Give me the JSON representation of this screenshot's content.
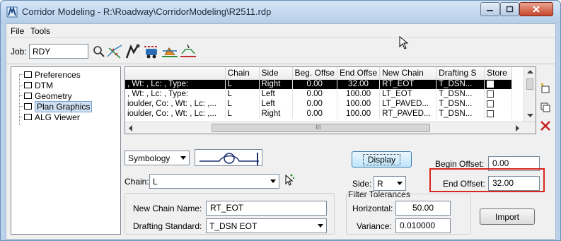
{
  "window": {
    "title": "Corridor Modeling - R:\\Roadway\\CorridorModeling\\R2511.rdp"
  },
  "menu": {
    "file": "File",
    "tools": "Tools"
  },
  "toolbar": {
    "job_label": "Job:",
    "job_value": "RDY"
  },
  "tree": {
    "items": [
      "Preferences",
      "DTM",
      "Geometry",
      "Plan Graphics",
      "ALG Viewer"
    ]
  },
  "grid": {
    "columns": [
      "",
      "Chain",
      "Side",
      "Beg. Offse",
      "End Offse",
      "New Chain",
      "Drafting S",
      "Store"
    ],
    "rows": [
      [
        ", Wt: , Lc: , Type:",
        "L",
        "Right",
        "0.00",
        "32.00",
        "RT_EOT",
        "T_DSN..."
      ],
      [
        ", Wt: , Lc: , Type:",
        "L",
        "Left",
        "0.00",
        "100.00",
        "LT_EOT",
        "T_DSN..."
      ],
      [
        "ioulder, Co: , Wt: , Lc: ,...",
        "L",
        "Left",
        "0.00",
        "100.00",
        "LT_PAVED...",
        "T_DSN..."
      ],
      [
        "ioulder, Co: , Wt: , Lc: ,...",
        "L",
        "Right",
        "0.00",
        "100.00",
        "RT_PAVED...",
        "T_DSN..."
      ]
    ],
    "scroll_marker": "III"
  },
  "form": {
    "symbology_label": "Symbology",
    "chain_label": "Chain:",
    "chain_value": "L",
    "display_button": "Display",
    "begin_offset_label": "Begin Offset:",
    "begin_offset_value": "0.00",
    "end_offset_label": "End Offset:",
    "end_offset_value": "32.00",
    "side_label": "Side:",
    "side_value": "R",
    "filter_tolerances_label": "Filter Tolerances",
    "horizontal_label": "Horizontal:",
    "horizontal_value": "50.00",
    "variance_label": "Variance:",
    "variance_value": "0.010000",
    "new_chain_name_label": "New Chain Name:",
    "new_chain_name_value": "RT_EOT",
    "drafting_standard_label": "Drafting Standard:",
    "drafting_standard_value": "T_DSN EOT",
    "import_button": "Import"
  },
  "colors": {
    "highlight": "#d8261f",
    "selected_row": "#000000",
    "window_frame": "#b9d1ea"
  }
}
